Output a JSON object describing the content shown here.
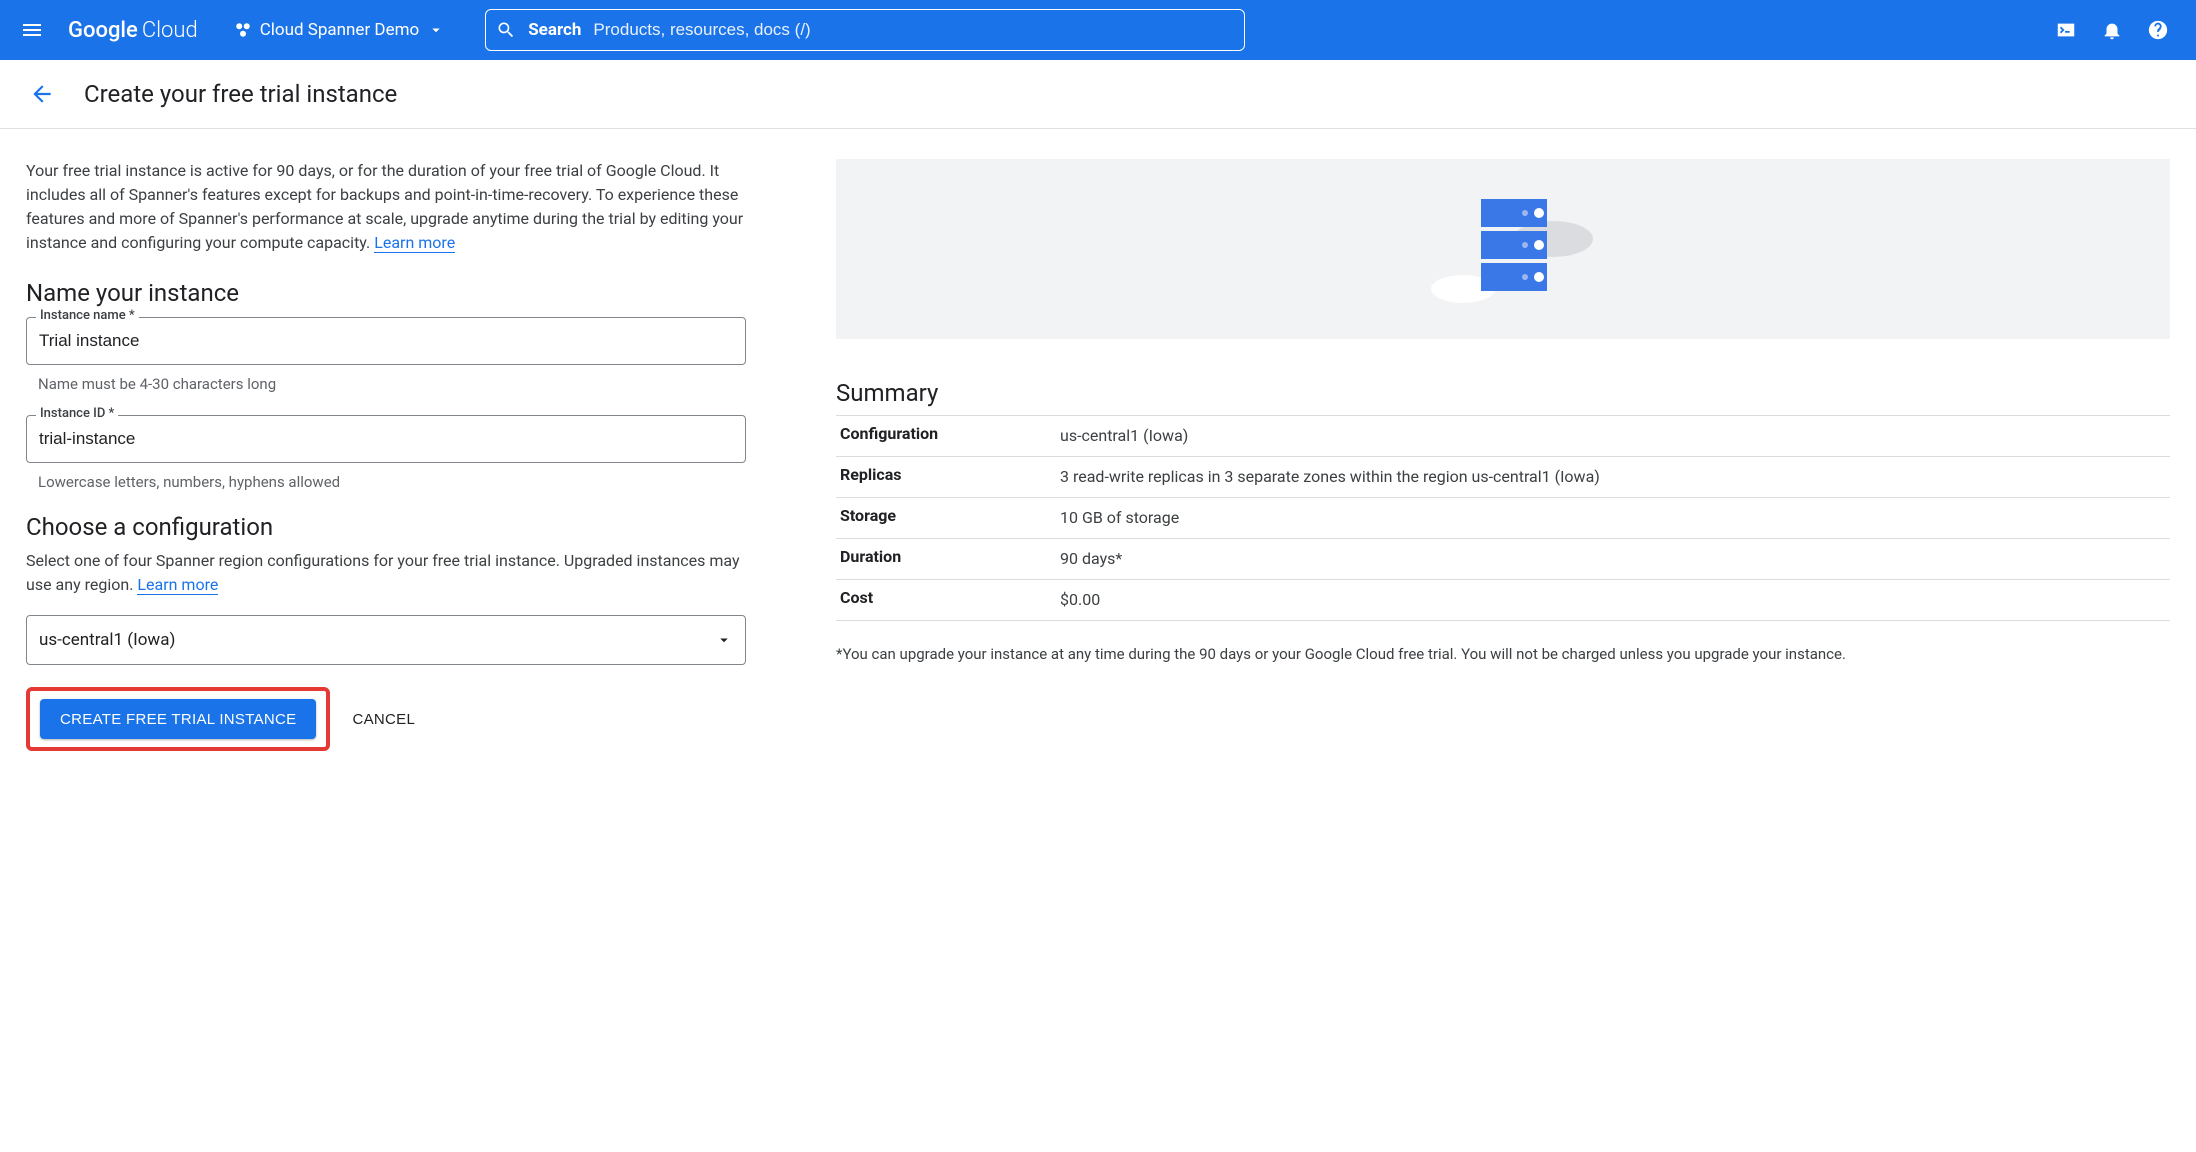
{
  "topbar": {
    "brand_google": "Google",
    "brand_cloud": "Cloud",
    "project_name": "Cloud Spanner Demo",
    "search_label": "Search",
    "search_placeholder": "Products, resources, docs (/)"
  },
  "page": {
    "title": "Create your free trial instance",
    "intro_text": "Your free trial instance is active for 90 days, or for the duration of your free trial of Google Cloud. It includes all of Spanner's features except for backups and point-in-time-recovery. To experience these features and more of Spanner's performance at scale, upgrade anytime during the trial by editing your instance and configuring your compute capacity. ",
    "learn_more": "Learn more",
    "section_name_title": "Name your instance",
    "instance_name_label": "Instance name *",
    "instance_name_value": "Trial instance",
    "instance_name_hint": "Name must be 4-30 characters long",
    "instance_id_label": "Instance ID *",
    "instance_id_value": "trial-instance",
    "instance_id_hint": "Lowercase letters, numbers, hyphens allowed",
    "section_config_title": "Choose a configuration",
    "config_desc": "Select one of four Spanner region configurations for your free trial instance. Upgraded instances may use any region. ",
    "config_selected": "us-central1 (Iowa)",
    "create_btn": "CREATE FREE TRIAL INSTANCE",
    "cancel_btn": "CANCEL"
  },
  "summary": {
    "title": "Summary",
    "rows": [
      {
        "k": "Configuration",
        "v": "us-central1 (Iowa)"
      },
      {
        "k": "Replicas",
        "v": "3 read-write replicas in 3 separate zones within the region us-central1 (Iowa)"
      },
      {
        "k": "Storage",
        "v": "10 GB of storage"
      },
      {
        "k": "Duration",
        "v": "90 days*"
      },
      {
        "k": "Cost",
        "v": "$0.00"
      }
    ],
    "footnote": "*You can upgrade your instance at any time during the 90 days or your Google Cloud free trial. You will not be charged unless you upgrade your instance."
  }
}
